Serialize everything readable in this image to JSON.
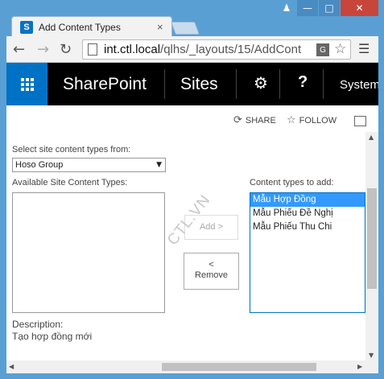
{
  "browser": {
    "tab_title": "Add Content Types",
    "tab_close": "×",
    "url_host": "int.ctl.local",
    "url_path": "/qlhs/_layouts/15/AddCont",
    "favicon_letter": "S"
  },
  "suite": {
    "brand": "SharePoint",
    "sites": "Sites",
    "user": "System"
  },
  "actions": {
    "share": "SHARE",
    "follow": "FOLLOW"
  },
  "form": {
    "select_from_label": "Select site content types from:",
    "select_from_value": "Hoso Group",
    "available_label": "Available Site Content Types:",
    "to_add_label": "Content types to add:",
    "to_add_items": [
      "Mẫu Hợp Đồng",
      "Mẫu Phiếu Đề Nghị",
      "Mẫu Phiếu Thu Chi"
    ],
    "selected_index": 0,
    "add_button": "Add >",
    "remove_arrow": "<",
    "remove_button": "Remove",
    "description_label": "Description:",
    "description_text": "Tạo hợp đồng mới"
  },
  "watermark": "CTL.VN",
  "colors": {
    "window_frame": "#5a9fd4",
    "suite_bar": "#000000",
    "waffle": "#0072c6",
    "selection": "#3399ff",
    "close_button": "#c7453a"
  }
}
